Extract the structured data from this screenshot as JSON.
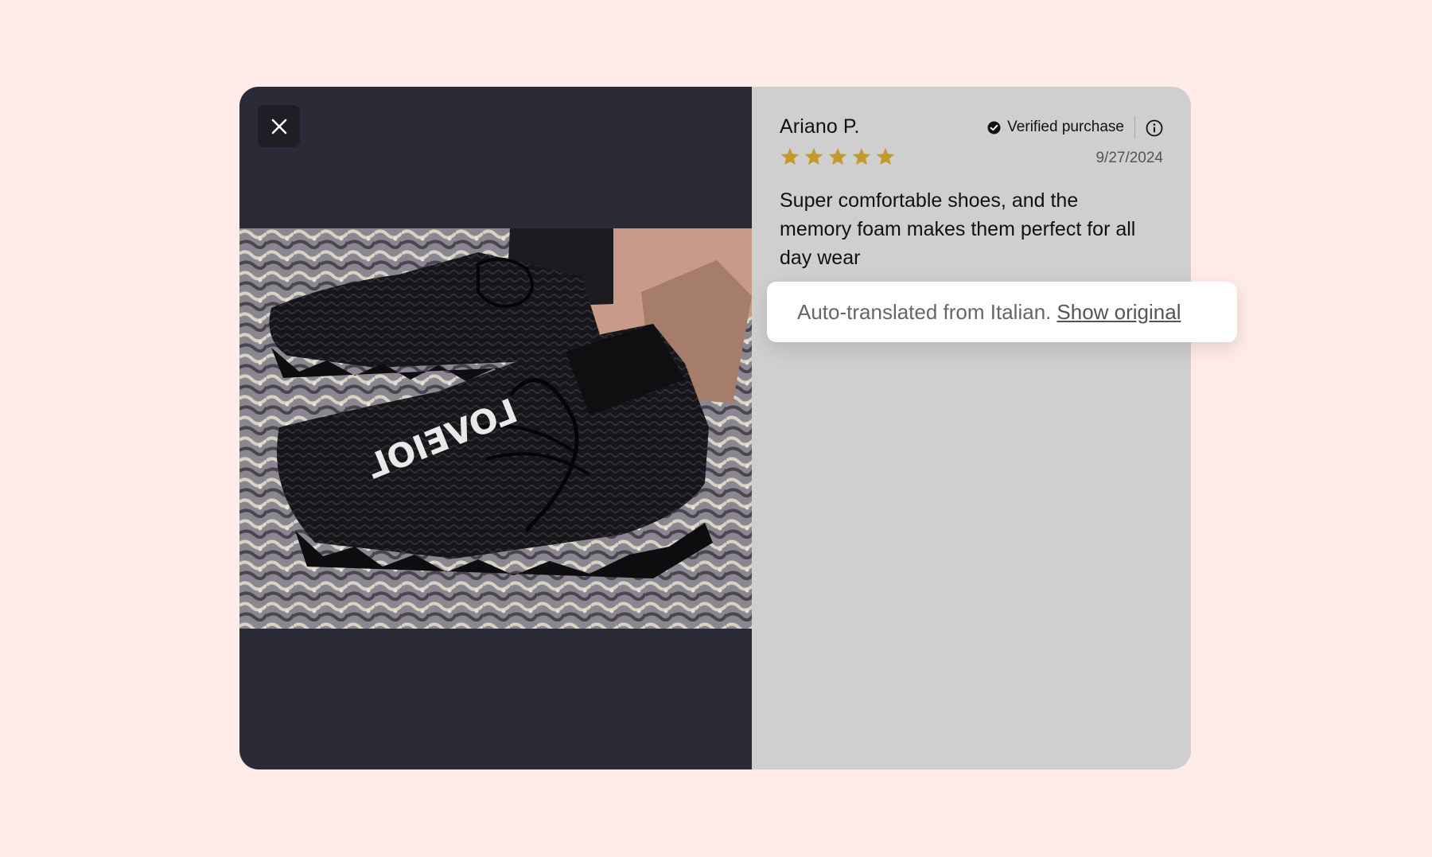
{
  "review": {
    "reviewer_name": "Ariano P.",
    "verified_label": "Verified purchase",
    "rating": 5,
    "max_rating": 5,
    "date": "9/27/2024",
    "body": "Super comfortable shoes, and the memory foam makes them perfect for all day wear"
  },
  "translation": {
    "notice": "Auto-translated from Italian.",
    "link_label": "Show original"
  },
  "photo": {
    "shoe_text": "LOVEIOL"
  },
  "colors": {
    "page_background": "#ffebe8",
    "media_background": "#2b2a37",
    "review_panel": "#cfcfcf",
    "star": "#c49a2c"
  },
  "icons": {
    "close": "close-icon",
    "verified": "check-circle-icon",
    "info": "info-icon",
    "star": "star-icon"
  }
}
